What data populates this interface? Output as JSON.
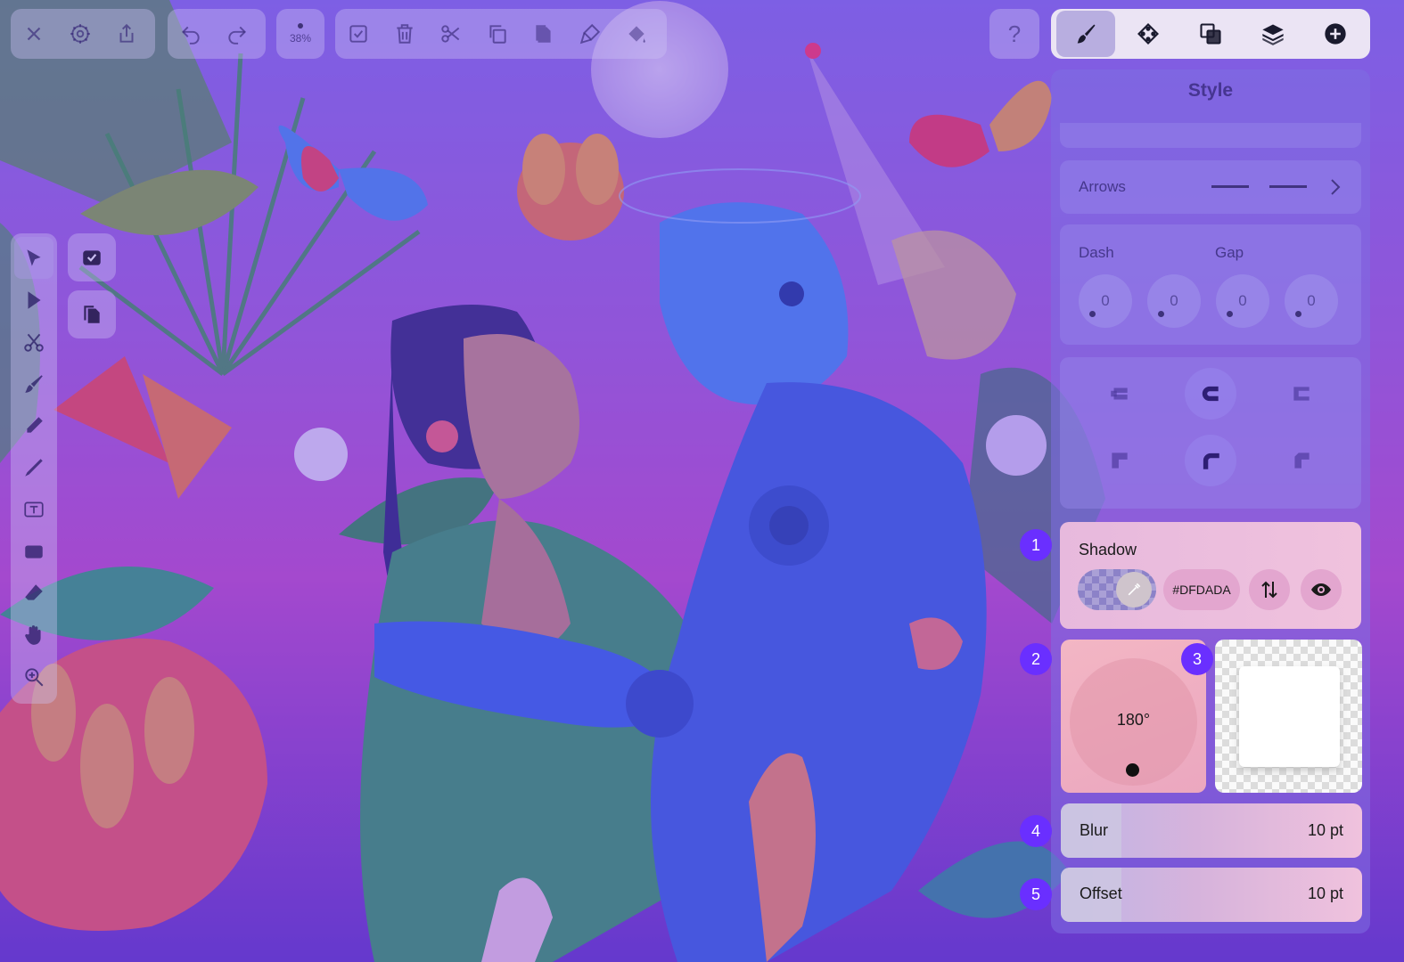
{
  "colors": {
    "accent_badge": "#6a2fff",
    "panel_tab_active": "#b8aee0",
    "shadow_color": "#DFDADA"
  },
  "toolbar": {
    "left_icons": [
      "close-icon",
      "settings-icon",
      "share-icon"
    ],
    "history_icons": [
      "undo-icon",
      "redo-icon"
    ],
    "zoom_label": "38%",
    "edit_icons": [
      "select-check-icon",
      "trash-icon",
      "scissors-icon",
      "copy-icon",
      "paste-icon",
      "paste-style-icon",
      "fill-icon"
    ],
    "help_label": "?"
  },
  "right_tabs": [
    "style-tab",
    "arrange-tab",
    "boolean-tab",
    "layers-tab",
    "add-tab"
  ],
  "left_tools": [
    "select-tool",
    "direct-select-tool",
    "scissors-tool",
    "brush-tool",
    "pencil-tool",
    "pen-tool",
    "text-tool",
    "shape-tool",
    "eraser-tool",
    "hand-tool",
    "zoom-tool"
  ],
  "panel": {
    "title": "Style",
    "arrows_label": "Arrows",
    "dash_label": "Dash",
    "gap_label": "Gap",
    "dash_values": [
      "0",
      "0",
      "0",
      "0"
    ]
  },
  "shadow": {
    "badge": "1",
    "title": "Shadow",
    "color_hex": "#DFDADA",
    "visible": true
  },
  "angle": {
    "badge": "2",
    "value": "180°"
  },
  "preview": {
    "badge": "3"
  },
  "blur": {
    "badge": "4",
    "label": "Blur",
    "value": "10 pt",
    "fill_fraction": 0.2
  },
  "offset": {
    "badge": "5",
    "label": "Offset",
    "value": "10 pt",
    "fill_fraction": 0.2
  }
}
